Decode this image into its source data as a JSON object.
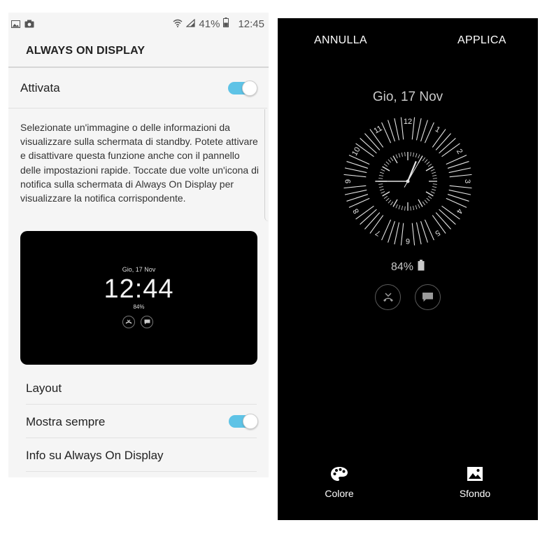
{
  "status_bar": {
    "battery_percent": "41%",
    "time": "12:45",
    "icons": [
      "image-icon",
      "camera-icon",
      "wifi-icon",
      "signal-icon",
      "battery-icon"
    ]
  },
  "settings": {
    "title": "ALWAYS ON DISPLAY",
    "master_toggle": {
      "label": "Attivata",
      "on": true
    },
    "description": "Selezionate un'immagine o delle informazioni da visualizzare sulla schermata di standby. Potete attivare e disattivare questa funzione anche con il pannello delle impostazioni rapide. Toccate due volte un'icona di notifica sulla schermata di Always On Display per visualizzare la notifica corrispondente.",
    "preview": {
      "date": "Gio, 17 Nov",
      "time": "12:44",
      "battery": "84%",
      "icons": [
        "missed-call-icon",
        "message-icon"
      ]
    },
    "menu": [
      {
        "label": "Layout"
      },
      {
        "label": "Mostra sempre",
        "toggle_on": true
      },
      {
        "label": "Info su Always On Display"
      }
    ]
  },
  "editor": {
    "cancel_label": "ANNULLA",
    "apply_label": "APPLICA",
    "date": "Gio, 17 Nov",
    "clock": {
      "hour_numbers": [
        "12",
        "1",
        "2",
        "3",
        "4",
        "5",
        "6",
        "7",
        "8",
        "9",
        "10",
        "11"
      ],
      "hour": 12,
      "minute": 45,
      "second": 5
    },
    "battery": "84%",
    "notification_icons": [
      "missed-call-icon",
      "message-icon"
    ],
    "bottom_buttons": [
      {
        "label": "Colore",
        "icon": "palette-icon"
      },
      {
        "label": "Sfondo",
        "icon": "image-icon"
      }
    ],
    "colors": {
      "background": "#000000",
      "clock": "#e6e6e6",
      "toggle": "#5ec3e6"
    }
  }
}
